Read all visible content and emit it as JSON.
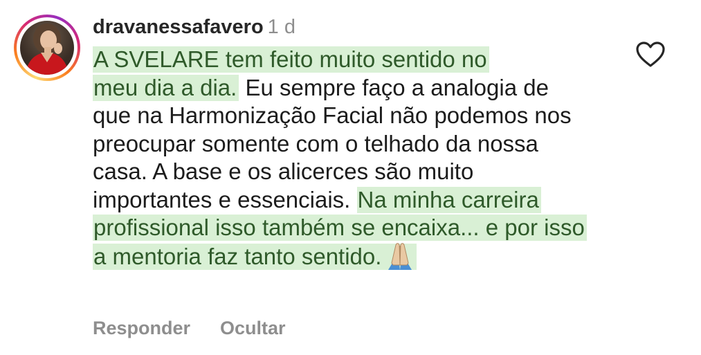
{
  "comment": {
    "username": "dravanessafavero",
    "time_ago": "1 d",
    "segments": {
      "hl1_line1": "A SVELARE tem feito muito sentido no",
      "hl1_line2": "meu dia a dia.",
      "plain": " Eu sempre faço a analogia de que na Harmonização Facial não podemos nos preocupar somente com o telhado da nossa casa. A base e os alicerces são muito importantes e essenciais.",
      "hl2": "Na minha carreira profissional isso também se encaixa... e por isso a mentoria faz tanto sentido."
    },
    "emoji": "folded-hands",
    "highlight_color": "#d9f0d5",
    "highlight_text_color": "#2f5a2a"
  },
  "actions": {
    "reply_label": "Responder",
    "hide_label": "Ocultar"
  },
  "icons": {
    "like": "heart-outline-icon",
    "avatar": "profile-photo"
  }
}
